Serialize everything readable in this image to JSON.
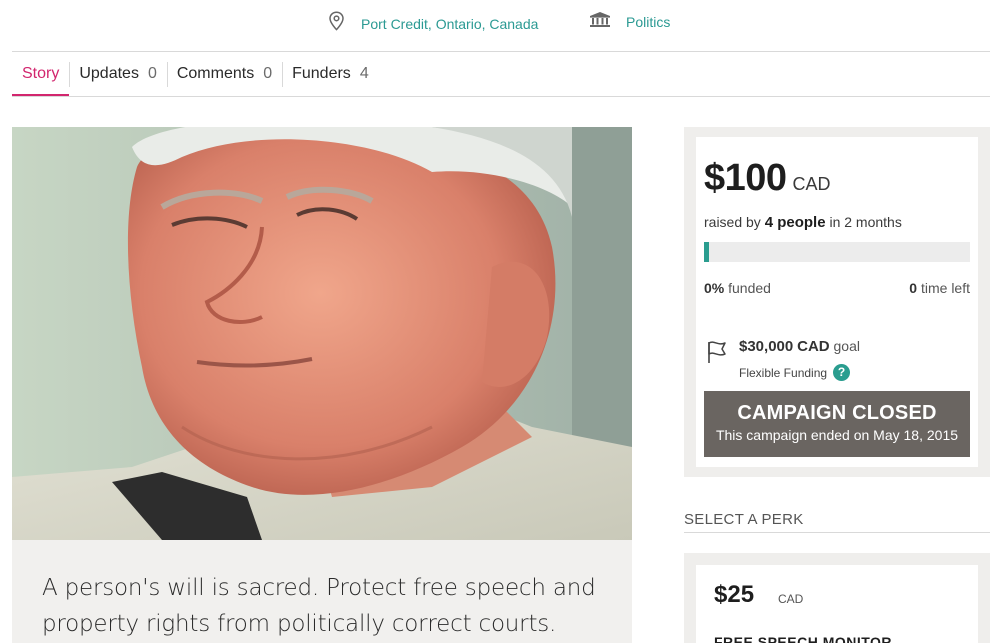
{
  "meta": {
    "location": "Port Credit, Ontario, Canada",
    "category": "Politics"
  },
  "tabs": [
    {
      "label": "Story",
      "count": ""
    },
    {
      "label": "Updates",
      "count": "0"
    },
    {
      "label": "Comments",
      "count": "0"
    },
    {
      "label": "Funders",
      "count": "4"
    }
  ],
  "story": {
    "tagline": "A person's will is sacred. Protect free speech and property rights from politically correct courts."
  },
  "campaign": {
    "amount": "$100",
    "currency": "CAD",
    "raised_prefix": "raised by",
    "people": "4 people",
    "duration": "in 2 months",
    "progress_fraction": 0.02,
    "funded_pct": "0%",
    "funded_label": "funded",
    "time_left_value": "0",
    "time_left_label": "time left",
    "goal_amount": "$30,000",
    "goal_currency": "CAD",
    "goal_label": "goal",
    "funding_type": "Flexible Funding",
    "help_glyph": "?",
    "closed_title": "CAMPAIGN CLOSED",
    "closed_sub": "This campaign ended on May 18, 2015"
  },
  "perks": {
    "heading": "SELECT A PERK",
    "items": [
      {
        "amount": "$25",
        "currency": "CAD",
        "title": "FREE SPEECH MONITOR"
      }
    ]
  },
  "colors": {
    "accent": "#d2266e",
    "link": "#2b9a93",
    "progress": "#2a9d8f",
    "closed_bg": "#6a6561"
  },
  "icons": {
    "location": "map-pin-icon",
    "category": "bank-building-icon",
    "goal": "flag-icon",
    "help": "question-icon"
  }
}
